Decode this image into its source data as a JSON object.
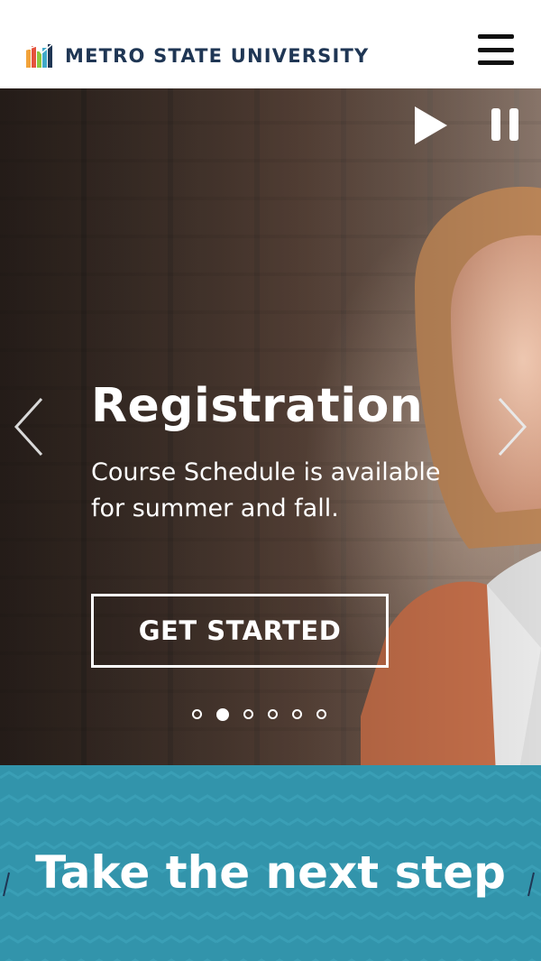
{
  "header": {
    "logo_text": "METRO STATE UNIVERSITY",
    "menu_icon": "hamburger-menu-icon"
  },
  "hero": {
    "controls": {
      "play_icon": "play-icon",
      "pause_icon": "pause-icon"
    },
    "prev_icon": "chevron-left-icon",
    "next_icon": "chevron-right-icon",
    "title": "Registration",
    "text": "Course Schedule is available for summer and fall.",
    "cta_label": "GET STARTED",
    "slides_total": 6,
    "active_slide": 2
  },
  "next_step": {
    "title": "Take the next step"
  },
  "colors": {
    "brand_navy": "#1f3654",
    "band_teal": "#3294ab"
  }
}
